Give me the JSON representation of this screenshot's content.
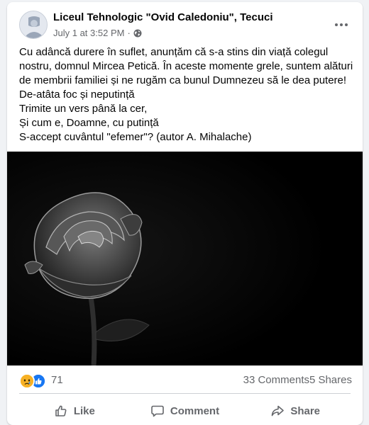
{
  "post": {
    "page_name": "Liceul Tehnologic \"Ovid Caledoniu\", Tecuci",
    "timestamp": "July 1 at 3:52 PM",
    "privacy_icon": "globe-icon",
    "text": "Cu adâncă durere în suflet, anunțăm că s-a stins din viață colegul nostru, domnul Mircea Petică. În aceste momente grele, suntem alături de membrii familiei și ne rugăm ca bunul Dumnezeu să le dea putere!\nDe-atâta foc și neputință\nTrimite un vers până la cer,\nȘi cum e, Doamne, cu putință\nS-accept cuvântul \"efemer\"? (autor A. Mihalache)",
    "image": "black-and-white-rose-photo"
  },
  "reactions": {
    "icons": [
      "sad-reaction-icon",
      "like-reaction-icon"
    ],
    "count": "71",
    "comments": "33 Comments",
    "shares": "5 Shares"
  },
  "actions": {
    "like_label": "Like",
    "comment_label": "Comment",
    "share_label": "Share"
  },
  "colors": {
    "secondary_text": "#65676b",
    "like_blue": "#1877f2",
    "sad_yellow": "#f7b125"
  }
}
